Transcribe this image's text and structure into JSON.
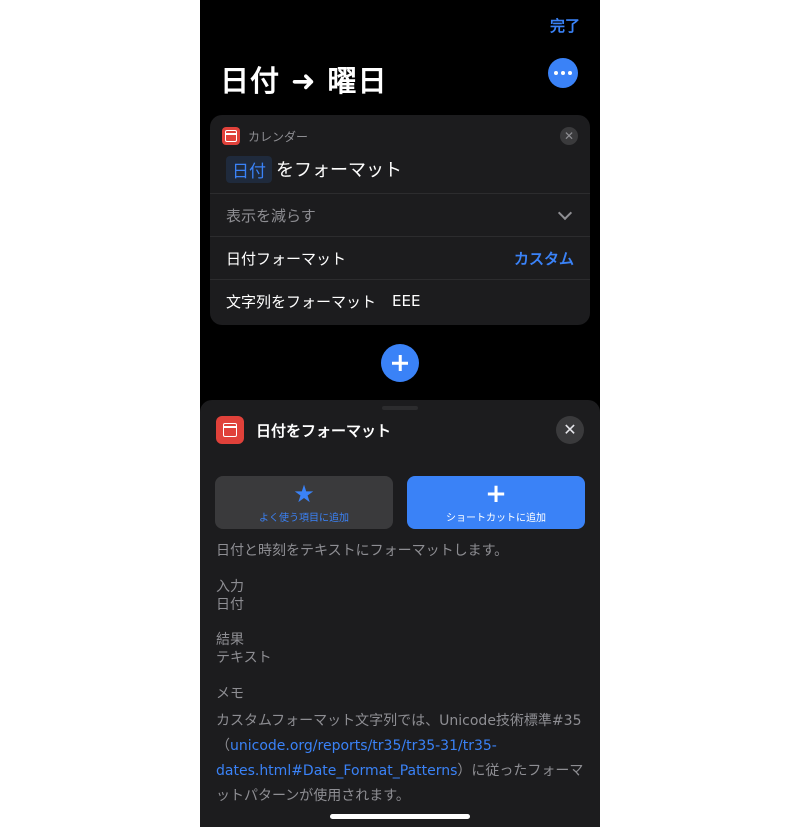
{
  "header": {
    "done_label": "完了",
    "title": "日付 ➜ 曜日"
  },
  "action_card": {
    "app_name": "カレンダー",
    "token": "日付",
    "action_text": "をフォーマット",
    "collapse_label": "表示を減らす",
    "date_format_label": "日付フォーマット",
    "date_format_value": "カスタム",
    "format_string_label": "文字列をフォーマット",
    "format_string_value": "EEE"
  },
  "sheet": {
    "title": "日付をフォーマット",
    "favorite_label": "よく使う項目に追加",
    "add_shortcut_label": "ショートカットに追加",
    "description": "日付と時刻をテキストにフォーマットします。",
    "input_label": "入力",
    "input_value": "日付",
    "result_label": "結果",
    "result_value": "テキスト",
    "memo_label": "メモ",
    "memo_text_before": "カスタムフォーマット文字列では、Unicode技術標準#35（",
    "memo_link": "unicode.org/reports/tr35/tr35-31/tr35-dates.html#Date_Format_Patterns",
    "memo_text_after": "）に従ったフォーマットパターンが使用されます。"
  },
  "icons": {
    "app_icon": "calendar-icon",
    "more": "ellipsis-icon",
    "close": "close-icon",
    "chevron": "chevron-down-icon",
    "star": "star-icon",
    "plus": "plus-icon"
  },
  "colors": {
    "accent": "#3a82f7",
    "background": "#000000",
    "card": "#1c1c1e",
    "calendar_red": "#e0413a",
    "secondary_text": "#8e8e93"
  }
}
